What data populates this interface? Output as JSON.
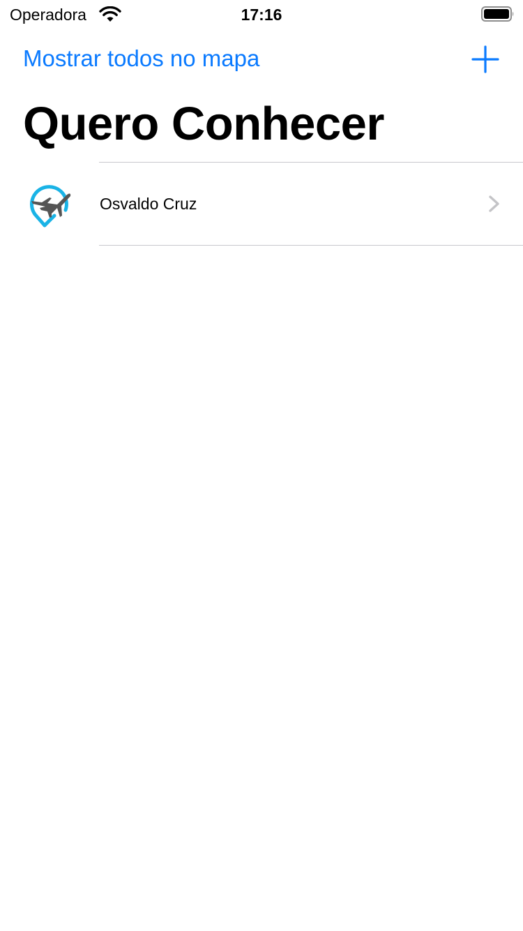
{
  "status_bar": {
    "carrier": "Operadora",
    "time": "17:16"
  },
  "nav_bar": {
    "show_all_label": "Mostrar todos no mapa",
    "add_icon": "plus-icon"
  },
  "page": {
    "title": "Quero Conhecer"
  },
  "list": {
    "items": [
      {
        "label": "Osvaldo Cruz",
        "icon": "plane-pin-icon"
      }
    ]
  },
  "colors": {
    "accent": "#0a7aff",
    "pin": "#1ab3e6",
    "plane": "#555555",
    "separator": "#c8c7cc",
    "chevron": "#c4c4c7"
  }
}
